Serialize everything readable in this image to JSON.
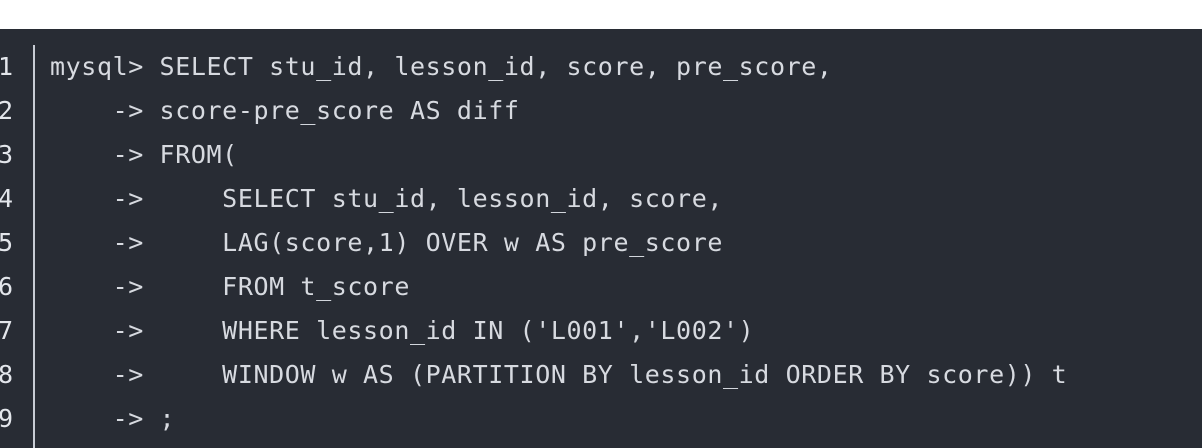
{
  "code": {
    "lines": [
      {
        "number": "1",
        "text": "mysql> SELECT stu_id, lesson_id, score, pre_score,"
      },
      {
        "number": "2",
        "text": "    -> score-pre_score AS diff"
      },
      {
        "number": "3",
        "text": "    -> FROM("
      },
      {
        "number": "4",
        "text": "    ->     SELECT stu_id, lesson_id, score,"
      },
      {
        "number": "5",
        "text": "    ->     LAG(score,1) OVER w AS pre_score"
      },
      {
        "number": "6",
        "text": "    ->     FROM t_score"
      },
      {
        "number": "7",
        "text": "    ->     WHERE lesson_id IN ('L001','L002')"
      },
      {
        "number": "8",
        "text": "    ->     WINDOW w AS (PARTITION BY lesson_id ORDER BY score)) t"
      },
      {
        "number": "9",
        "text": "    -> ;"
      }
    ]
  },
  "colors": {
    "panel_background": "#282c34",
    "code_text": "#d7dae0",
    "line_numbers": "#e3e6eb",
    "divider": "#c8ccd4"
  }
}
